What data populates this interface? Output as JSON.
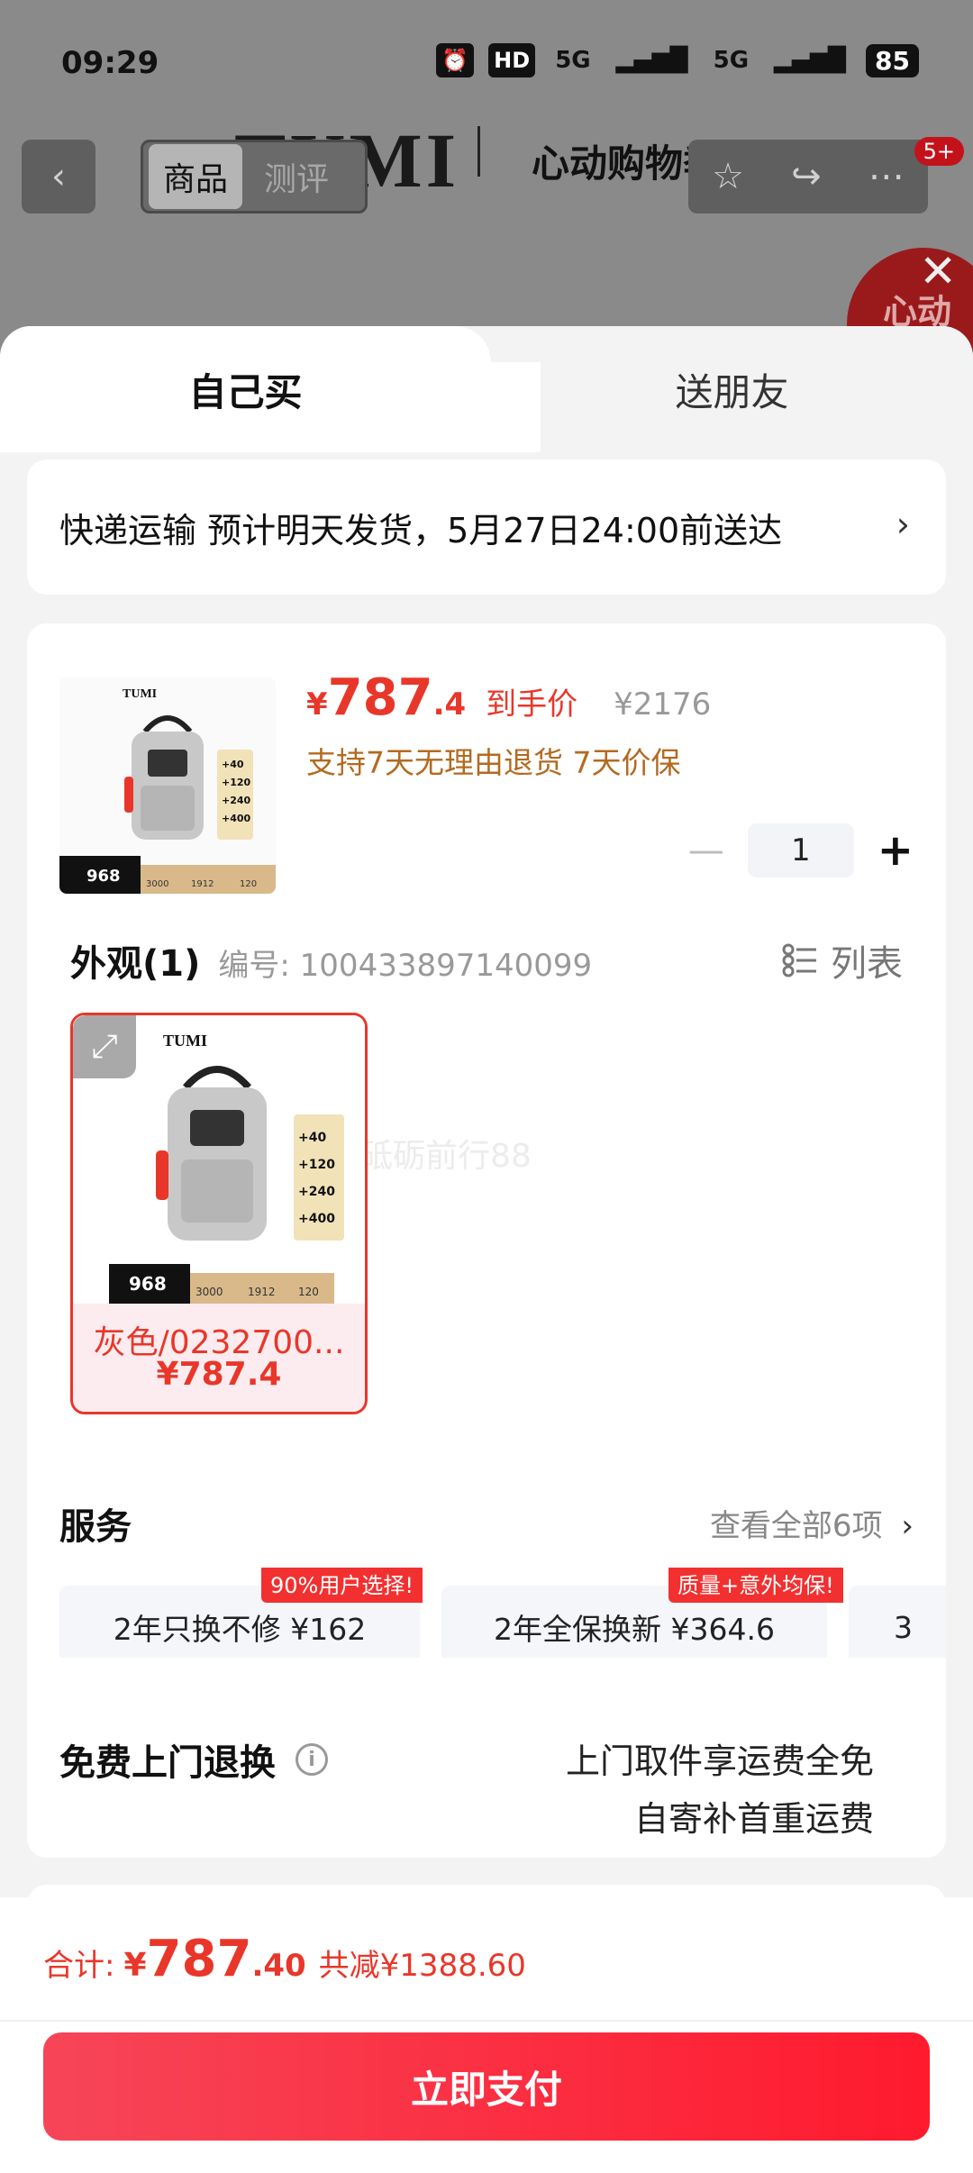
{
  "status_bar": {
    "time": "09:29",
    "hd": "HD",
    "net1": "5G",
    "net2": "5G",
    "battery": "85"
  },
  "nav": {
    "tab_goods": "商品",
    "tab_review": "测评",
    "brand": "TUMI",
    "brand2": "心动购物季",
    "notif_badge": "5+",
    "promo": "心动"
  },
  "sheet": {
    "tab_self": "自己买",
    "tab_friend": "送朋友",
    "delivery": "快递运输 预计明天发货，5月27日24:00前送达",
    "product": {
      "price_symbol": "¥",
      "price_int": "787",
      "price_dec": ".4",
      "arrive_label": "到手价",
      "orig_price": "¥2176",
      "support": "支持7天无理由退货 7天价保",
      "quantity": "1",
      "thumb_price": "968",
      "thumb_brand": "TUMI",
      "thumb_values": [
        "+40",
        "+120",
        "+240",
        "+400"
      ],
      "thumb_bar": [
        "3000",
        "1912",
        "120"
      ]
    },
    "appearance": {
      "title": "外观(1)",
      "code": "编号: 100433897140099",
      "list_label": "列表",
      "watermark": "砥砺前行88",
      "variant_name": "灰色/0232700...",
      "variant_price": "¥787.4"
    },
    "services": {
      "title": "服务",
      "view_all": "查看全部6项",
      "items": [
        {
          "label": "2年只换不修 ¥162",
          "tag": "90%用户选择!"
        },
        {
          "label": "2年全保换新 ¥364.6",
          "tag": "质量+意外均保!"
        },
        {
          "label": "3",
          "tag": ""
        }
      ]
    },
    "free_return": {
      "title": "免费上门退换",
      "line1": "上门取件享运费全免",
      "line2": "自寄补首重运费"
    }
  },
  "footer": {
    "total_label": "合计:",
    "symbol": "¥",
    "total_int": "787",
    "total_dec": ".40",
    "saved": "共减¥1388.60",
    "pay_button": "立即支付"
  }
}
